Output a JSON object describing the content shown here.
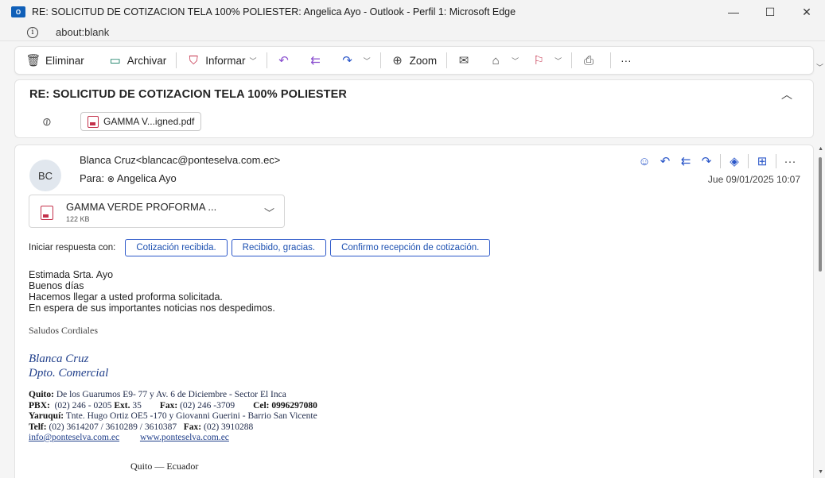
{
  "window": {
    "app_icon": "O",
    "title": "RE: SOLICITUD DE COTIZACION TELA 100% POLIESTER: Angelica Ayo - Outlook - Perfil 1: Microsoft Edge",
    "minimize": "—",
    "maximize": "☐",
    "close": "✕"
  },
  "address": {
    "info_glyph": "i",
    "url": "about:blank"
  },
  "toolbar": {
    "delete": "Eliminar",
    "archive": "Archivar",
    "report": "Informar",
    "zoom": "Zoom",
    "more": "···"
  },
  "message": {
    "subject": "RE: SOLICITUD DE COTIZACION TELA 100% POLIESTER",
    "top_attachment": "GAMMA V...igned.pdf",
    "avatar_initials": "BC",
    "sender": "Blanca Cruz<blancac@ponteselva.com.ec>",
    "to_label": "Para:",
    "to_name": "Angelica Ayo",
    "datetime": "Jue 09/01/2025 10:07",
    "attachment_name": "GAMMA VERDE PROFORMA ...",
    "attachment_size": "122 KB",
    "quick_reply_label": "Iniciar respuesta con:",
    "quick_replies": [
      "Cotización recibida.",
      "Recibido, gracias.",
      "Confirmo recepción de cotización."
    ],
    "body": [
      "Estimada Srta. Ayo",
      "Buenos días",
      "Hacemos llegar a usted proforma solicitada.",
      "En espera de sus importantes noticias nos despedimos."
    ],
    "greeting": "Saludos Cordiales",
    "signature_name": "Blanca Cruz",
    "signature_dept": "Dpto. Comercial",
    "contact": {
      "quito_label": "Quito:",
      "quito_addr": "De los Guarumos E9- 77 y Av. 6 de Diciembre  -  Sector El Inca",
      "pbx_label": "PBX:",
      "pbx": "(02) 246 - 0205",
      "ext_label": "Ext.",
      "ext": "35",
      "fax_label": "Fax:",
      "fax": "(02) 246 -3709",
      "cel_label": "Cel:",
      "cel": "0996297080",
      "yaruqui_label": "Yaruquí:",
      "yaruqui_addr": "Tnte. Hugo Ortiz OE5 -170 y Giovanni Guerini - Barrio San Vicente",
      "telf_label": "Telf:",
      "telf": "(02) 3614207 / 3610289 / 3610387",
      "fax2_label": "Fax:",
      "fax2": "(02) 3910288",
      "email": "info@ponteselva.com.ec",
      "website": "www.ponteselva.com.ec"
    },
    "city": "Quito  —  Ecuador"
  }
}
